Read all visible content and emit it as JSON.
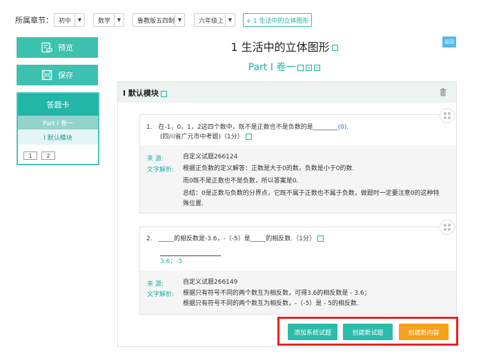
{
  "filter": {
    "label": "所属章节：",
    "selects": [
      "初中",
      "数学",
      "鲁教版五四制",
      "六年级上"
    ],
    "chapter_button": "+ 1 生活中的立体图形"
  },
  "sidebar": {
    "preview_label": "预览",
    "save_label": "保存",
    "answer_card_title": "答题卡",
    "part_label": "Part I 卷一",
    "module_label": "I 默认模块",
    "question_numbers": [
      "1",
      "2"
    ]
  },
  "main": {
    "title": "1 生活中的立体图形",
    "part_title": "Part I 卷一",
    "back_label": "返回",
    "module_title": "I 默认模块"
  },
  "questions": [
    {
      "number": "1.",
      "text": "在-1，0，1，2这四个数中，既不是正数也不是负数的是________",
      "answer": "(0).",
      "source_line": "(四川省广元市中考题)（1分）",
      "source_label": "来    源:",
      "source_value": "自定义试题266124",
      "explain_label": "文字解析:",
      "explain_lines": [
        "根据正负数的定义解答：正数是大于0的数，负数是小于0的数.",
        "而0既不是正数也不是负数，所以答案是0.",
        "总结：0是正数与负数的分界点，它既不属于正数也不属于负数，做题时一定要注意0的这种特",
        "殊位置."
      ]
    },
    {
      "number": "2.",
      "text": "_____的相反数是-3.6，-（-5）是_____的相反数.（1分）",
      "answer": "3.6；-5",
      "source_label": "来    源:",
      "source_value": "自定义试题266149",
      "explain_label": "文字解析:",
      "explain_lines": [
        "根据只有符号不同的两个数互为相反数，可得3.6的相反数是 - 3.6；",
        "根据只有符号不同的两个数互为相反数，-（-5）是 - 5的相反数."
      ]
    }
  ],
  "actions": {
    "add_system": "添加系统试题",
    "create_question": "创建新试题",
    "create_content": "创建新内容"
  },
  "colors": {
    "teal": "#1ab3a3",
    "button_teal": "#3dc1b0",
    "orange": "#f5a11c",
    "highlight_red": "#e51f1f",
    "back_blue": "#57b8ea"
  }
}
